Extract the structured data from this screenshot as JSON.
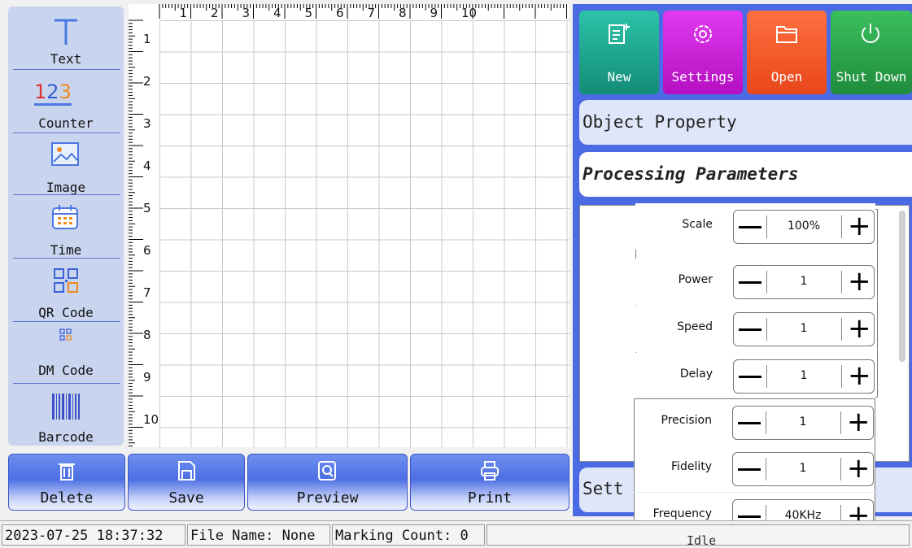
{
  "toolbar": {
    "items": [
      {
        "label": "Text",
        "icon": "text-icon"
      },
      {
        "label": "Counter",
        "icon": "counter-icon",
        "glyph": "123"
      },
      {
        "label": "Image",
        "icon": "image-icon"
      },
      {
        "label": "Time",
        "icon": "calendar-icon"
      },
      {
        "label": "QR Code",
        "icon": "qr-code-icon"
      },
      {
        "label": "DM Code",
        "icon": "dm-code-icon"
      },
      {
        "label": "Barcode",
        "icon": "barcode-icon"
      }
    ]
  },
  "ruler": {
    "top": [
      "1",
      "2",
      "3",
      "4",
      "5",
      "6",
      "7",
      "8",
      "9",
      "10"
    ],
    "left": [
      "1",
      "2",
      "3",
      "4",
      "5",
      "6",
      "7",
      "8",
      "9",
      "10"
    ]
  },
  "actions": {
    "delete": "Delete",
    "save": "Save",
    "preview": "Preview",
    "print": "Print"
  },
  "top_buttons": {
    "new": "New",
    "settings": "Settings",
    "open": "Open",
    "shutdown": "Shut Down"
  },
  "colors": {
    "new": "#1aa88f",
    "settings": "#cc1ad6",
    "open": "#f0582a",
    "shutdown": "#27a24a",
    "accent": "#4a6be4"
  },
  "panels": {
    "object_property": "Object Property",
    "processing_parameters": "Processing Parameters",
    "settings_partial": "Sett",
    "status_partial": "Idle"
  },
  "params": [
    {
      "name": "Scale",
      "value": "100%"
    },
    {
      "name": "Power",
      "value": "1"
    },
    {
      "name": "Speed",
      "value": "1"
    },
    {
      "name": "Delay",
      "value": "1"
    },
    {
      "name": "Precision",
      "value": "1"
    },
    {
      "name": "Fidelity",
      "value": "1"
    },
    {
      "name": "Frequency",
      "value": "40KHz"
    }
  ],
  "status": {
    "datetime": "2023-07-25 18:37:32",
    "file_name": "File Name: None",
    "marking_count": "Marking Count: 0"
  }
}
